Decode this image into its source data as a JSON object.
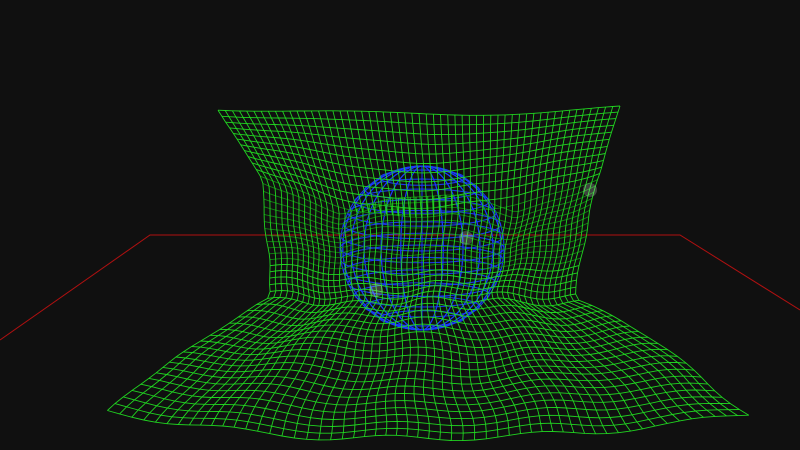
{
  "scene": {
    "background_color": "#101010",
    "floor_color": "#b01010",
    "cloth_color": "#22dd22",
    "cloth_color_dark": "#128a12",
    "cloth_highlight_color": "#e8ffe8",
    "sphere_color": "#1a3cff",
    "grid": {
      "rows": 48,
      "cols": 56
    }
  }
}
